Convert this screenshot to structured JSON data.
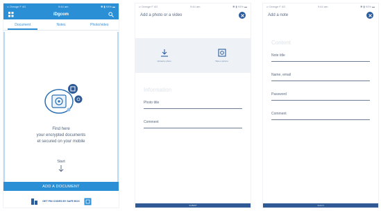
{
  "status_bar": {
    "carrier": "•• Orange F  4G",
    "time": "9:44 am",
    "battery": "✱ ▮ 93% ▬"
  },
  "screen1": {
    "header_title": "iDgcom",
    "tabs": [
      "Document",
      "Notes",
      "Photo/video"
    ],
    "message_lines": [
      "Find here",
      "your encrypted documents",
      "et secured on your mobile"
    ],
    "start_label": "Start",
    "add_button": "ADD A DOCUMENT",
    "banner_text": "GET PIN CODES BY SAFE BOX"
  },
  "screen2": {
    "title": "Add a photo or a video",
    "options": [
      "Upload a photo",
      "Take a picture"
    ],
    "section_title": "Information",
    "fields": [
      "Photo title",
      "Comment"
    ],
    "submit": "SUBMIT"
  },
  "screen3": {
    "title": "Add a note",
    "section_title": "Content",
    "fields": [
      "Note title",
      "Name, email",
      "Password",
      "Comment"
    ],
    "submit": "Submit"
  },
  "colors": {
    "primary": "#2b8fd6",
    "dark": "#2f5a96",
    "text": "#5a6a80"
  }
}
